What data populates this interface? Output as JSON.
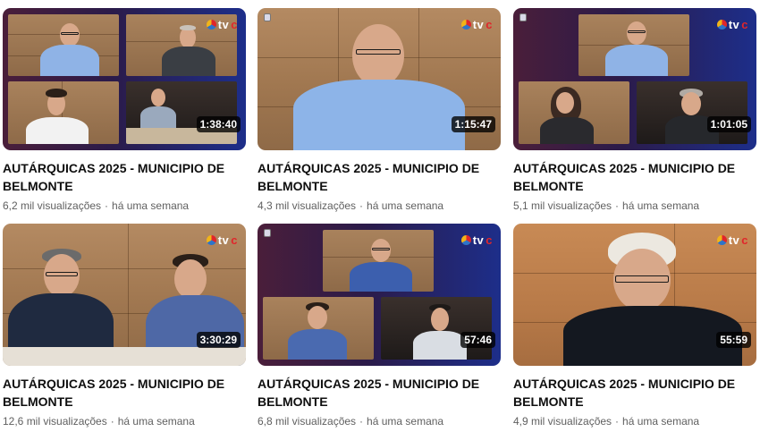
{
  "videos": [
    {
      "title": "AUTÁRQUICAS 2025 - MUNICIPIO DE BELMONTE",
      "views": "6,2 mil visualizações",
      "age": "há uma semana",
      "duration": "1:38:40",
      "channel_logo": "tvc"
    },
    {
      "title": "AUTÁRQUICAS 2025 - MUNICIPIO DE BELMONTE",
      "views": "4,3 mil visualizações",
      "age": "há uma semana",
      "duration": "1:15:47",
      "channel_logo": "tvc"
    },
    {
      "title": "AUTÁRQUICAS 2025 - MUNICIPIO DE BELMONTE",
      "views": "5,1 mil visualizações",
      "age": "há uma semana",
      "duration": "1:01:05",
      "channel_logo": "tvc"
    },
    {
      "title": "AUTÁRQUICAS 2025 - MUNICIPIO DE BELMONTE",
      "views": "12,6 mil visualizações",
      "age": "há uma semana",
      "duration": "3:30:29",
      "channel_logo": "tvc"
    },
    {
      "title": "AUTÁRQUICAS 2025 - MUNICIPIO DE BELMONTE",
      "views": "6,8 mil visualizações",
      "age": "há uma semana",
      "duration": "57:46",
      "channel_logo": "tvc"
    },
    {
      "title": "AUTÁRQUICAS 2025 - MUNICIPIO DE BELMONTE",
      "views": "4,9 mil visualizações",
      "age": "há uma semana",
      "duration": "55:59",
      "channel_logo": "tvc"
    }
  ],
  "colors": {
    "title": "#0f0f0f",
    "meta": "#606060",
    "panel_left": "#4a1e3a",
    "panel_right": "#1d2e8a",
    "wood": "#a07750"
  }
}
